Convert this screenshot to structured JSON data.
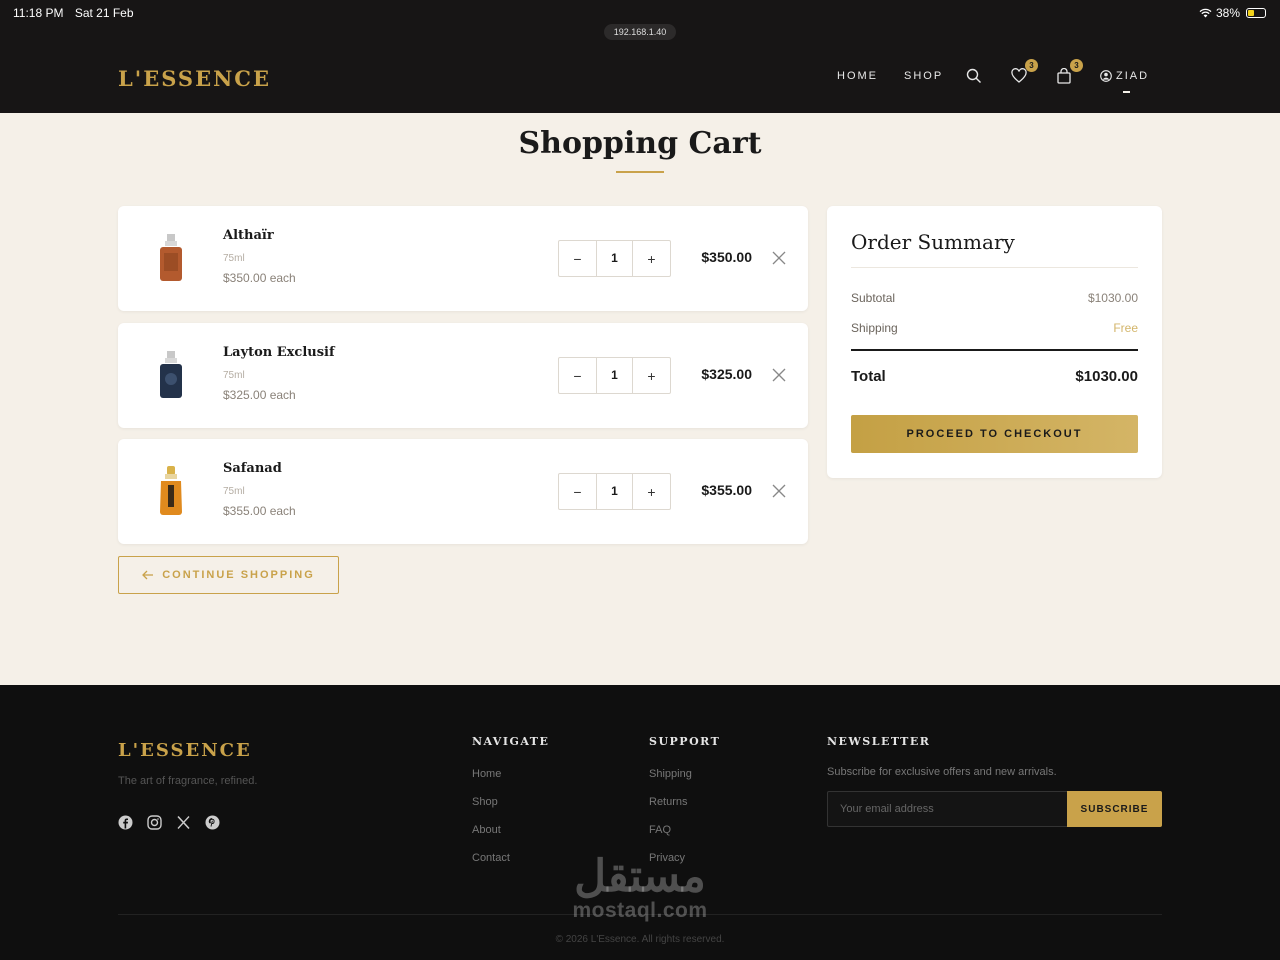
{
  "status_bar": {
    "time": "11:18 PM",
    "date": "Sat 21 Feb",
    "battery": "38%",
    "url": "192.168.1.40"
  },
  "header": {
    "brand": "L'ESSENCE",
    "nav": [
      "HOME",
      "SHOP"
    ],
    "wishlist_count": "3",
    "cart_count": "3",
    "user": "ZIAD"
  },
  "page": {
    "title": "Shopping Cart"
  },
  "cart": {
    "items": [
      {
        "name": "Althaïr",
        "size": "75ml",
        "each": "$350.00 each",
        "qty": "1",
        "total": "$350.00",
        "color": "#b35a2e"
      },
      {
        "name": "Layton Exclusif",
        "size": "75ml",
        "each": "$325.00 each",
        "qty": "1",
        "total": "$325.00",
        "color": "#23324a"
      },
      {
        "name": "Safanad",
        "size": "75ml",
        "each": "$355.00 each",
        "qty": "1",
        "total": "$355.00",
        "color": "#e08a1e"
      }
    ],
    "minus": "−",
    "plus": "+",
    "continue_label": "CONTINUE SHOPPING"
  },
  "summary": {
    "title": "Order Summary",
    "subtotal_label": "Subtotal",
    "subtotal": "$1030.00",
    "shipping_label": "Shipping",
    "shipping": "Free",
    "total_label": "Total",
    "total": "$1030.00",
    "checkout_label": "PROCEED TO CHECKOUT"
  },
  "footer": {
    "brand": "L'ESSENCE",
    "tagline": "The art of fragrance, refined.",
    "socials": [
      "facebook-icon",
      "instagram-icon",
      "x-icon",
      "pinterest-icon"
    ],
    "navigate_title": "NAVIGATE",
    "navigate": [
      "Home",
      "Shop",
      "About",
      "Contact"
    ],
    "support_title": "SUPPORT",
    "support": [
      "Shipping",
      "Returns",
      "FAQ",
      "Privacy"
    ],
    "newsletter_title": "NEWSLETTER",
    "newsletter_text": "Subscribe for exclusive offers and new arrivals.",
    "email_placeholder": "Your email address",
    "subscribe_label": "SUBSCRIBE",
    "copyright": "© 2026 L'Essence. All rights reserved."
  },
  "watermark": {
    "arabic": "مستقل",
    "latin": "mostaql.com"
  },
  "colors": {
    "gold": "#c9a24a",
    "dark": "#171515",
    "cream": "#f5f0e8"
  }
}
